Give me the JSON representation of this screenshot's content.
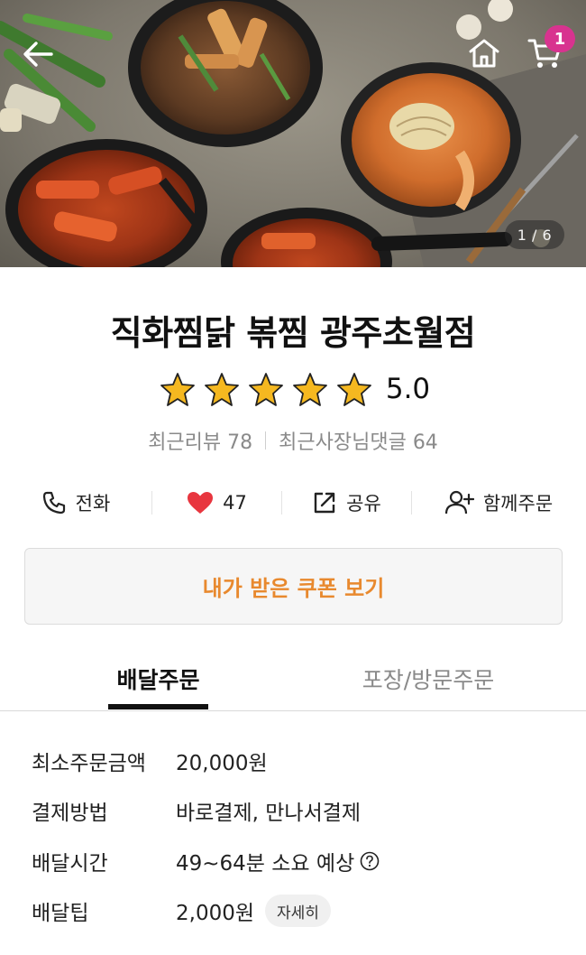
{
  "hero": {
    "page_indicator": "1 / 6",
    "cart_count": "1",
    "icons": {
      "back": "arrow-left-icon",
      "home": "home-icon",
      "cart": "cart-icon"
    }
  },
  "store": {
    "name": "직화찜닭 볶찜 광주초월점",
    "rating": "5.0",
    "rating_stars": 5,
    "recent_reviews": "최근리뷰 78",
    "recent_owner_replies": "최근사장님댓글 64"
  },
  "actions": {
    "call_label": "전화",
    "like_count": "47",
    "share_label": "공유",
    "group_order_label": "함께주문"
  },
  "coupon": {
    "label": "내가 받은 쿠폰 보기"
  },
  "tabs": {
    "delivery": "배달주문",
    "pickup": "포장/방문주문"
  },
  "info": {
    "min_order_label": "최소주문금액",
    "min_order_value": "20,000원",
    "payment_label": "결제방법",
    "payment_value": "바로결제, 만나서결제",
    "delivery_time_label": "배달시간",
    "delivery_time_value": "49~64분 소요 예상",
    "delivery_tip_label": "배달팁",
    "delivery_tip_value": "2,000원",
    "detail_label": "자세히"
  },
  "colors": {
    "accent_orange": "#e8892e",
    "badge_pink": "#d8338f",
    "heart_red": "#e8363f",
    "star_gold": "#f5b820"
  }
}
